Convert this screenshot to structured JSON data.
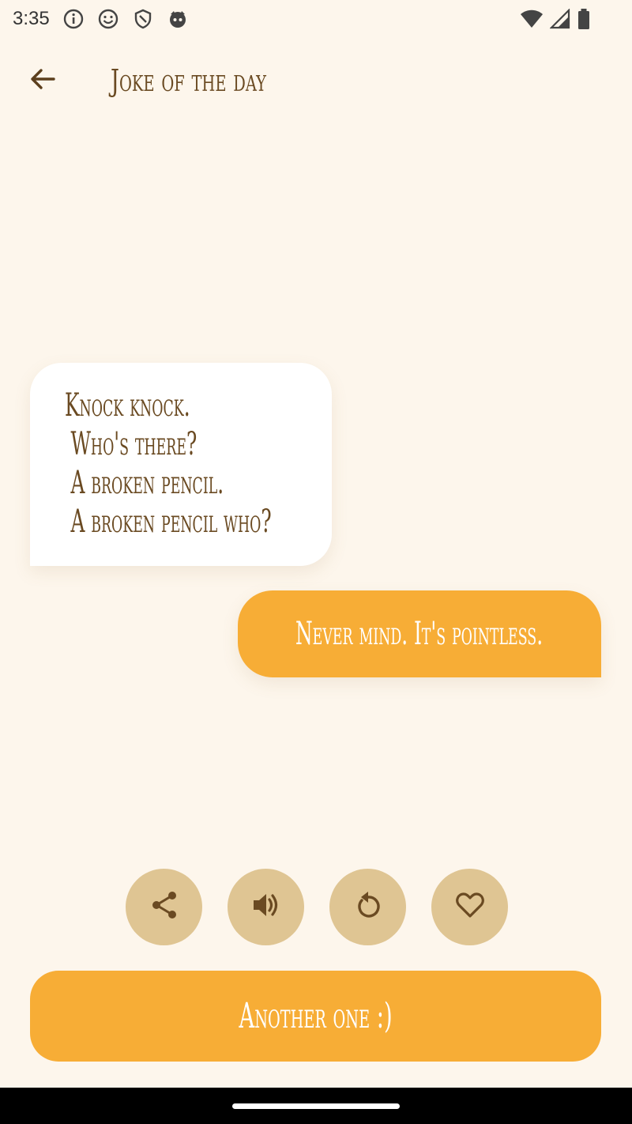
{
  "status_bar": {
    "time": "3:35",
    "icons": [
      "info-icon",
      "smiley-icon",
      "shield-icon",
      "cat-icon",
      "wifi-icon",
      "signal-icon",
      "battery-icon"
    ]
  },
  "app_bar": {
    "title": "Joke of the day"
  },
  "joke": {
    "setup_lines": [
      "Knock knock.",
      "Who's there?",
      "A broken pencil.",
      "A broken pencil who?"
    ],
    "punchline": "Never mind. It's pointless."
  },
  "actions": {
    "icons": [
      "share-icon",
      "speaker-icon",
      "refresh-icon",
      "heart-icon"
    ]
  },
  "primary_button": {
    "label": "Another one :)"
  },
  "colors": {
    "background": "#fdf6ec",
    "accent": "#f7ad36",
    "text_brown": "#6a4a22",
    "action_circle": "#dfc593"
  }
}
